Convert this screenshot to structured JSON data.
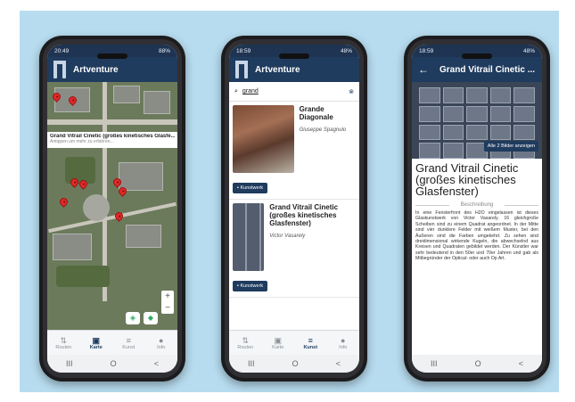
{
  "phone1": {
    "status_time": "20:49",
    "status_right": "88%",
    "app_title": "Artventure",
    "popup_title": "Grand Vitrail Cinetic (großes kinetisches Glasfe...",
    "popup_subtitle": "Antippen um mehr zu erfahren..."
  },
  "phone2": {
    "status_time": "18:59",
    "status_right": "48%",
    "app_title": "Artventure",
    "search_query": "grand",
    "results": [
      {
        "name": "Grande Diagonale",
        "artist": "Giuseppe Spagnulo",
        "badge": "Kunstwerk"
      },
      {
        "name": "Grand Vitrail Cinetic (großes kinetisches Glasfenster)",
        "artist": "Victor Vasarely",
        "badge": "Kunstwerk"
      }
    ]
  },
  "phone3": {
    "status_time": "18:59",
    "status_right": "48%",
    "app_title": "Grand Vitrail Cinetic ...",
    "show_images": "Alle 2 Bilder anzeigen",
    "title": "Grand Vitrail Cinetic (großes kinetisches Glasfenster)",
    "section": "Beschreibung",
    "body": "In eine Fensterfront des H2O eingelassen ist dieses Glaskunstwerk von Victor Vasarely. 16 gleichgroße Scheiben sind zu einem Quadrat angeordnet. In der Mitte sind vier dunklere Felder mit weißem Muster, bei den Äußeren sind die Farben umgekehrt. Zu sehen sind dreidimensional wirkende Kugeln, die abwechselnd aus Kreisen und Quadraten gebildet werden. Der Künstler war sehr bedeutend in den 50er und 70er Jahren und gab als Mitbegründer der Optical- oder auch Op Art."
  },
  "nav": {
    "routen": "Routen",
    "karte": "Karte",
    "kunst": "Kunst",
    "info": "Info"
  },
  "sysnav": {
    "recent": "III",
    "home": "O",
    "back": "<"
  },
  "icons": {
    "routes": "route-icon",
    "map": "map-icon",
    "art": "list-icon",
    "info": "info-icon"
  },
  "colors": {
    "appbar": "#1f3b5e",
    "accent": "#1f3b5e",
    "pin": "#e02a2a"
  }
}
